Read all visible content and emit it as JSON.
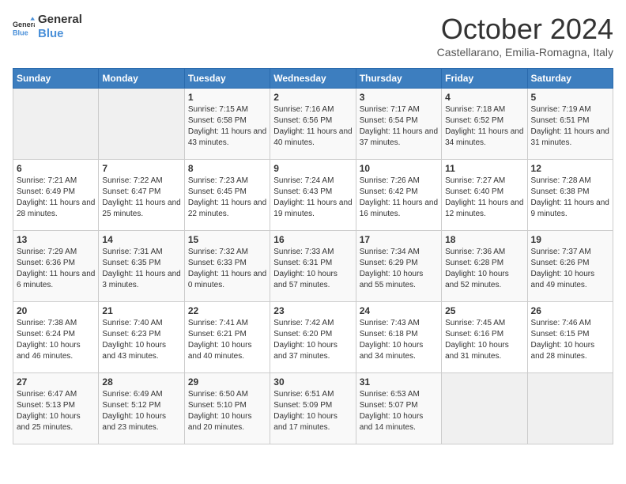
{
  "logo": {
    "line1": "General",
    "line2": "Blue"
  },
  "title": "October 2024",
  "location": "Castellarano, Emilia-Romagna, Italy",
  "headers": [
    "Sunday",
    "Monday",
    "Tuesday",
    "Wednesday",
    "Thursday",
    "Friday",
    "Saturday"
  ],
  "weeks": [
    [
      {
        "day": "",
        "info": ""
      },
      {
        "day": "",
        "info": ""
      },
      {
        "day": "1",
        "info": "Sunrise: 7:15 AM\nSunset: 6:58 PM\nDaylight: 11 hours and 43 minutes."
      },
      {
        "day": "2",
        "info": "Sunrise: 7:16 AM\nSunset: 6:56 PM\nDaylight: 11 hours and 40 minutes."
      },
      {
        "day": "3",
        "info": "Sunrise: 7:17 AM\nSunset: 6:54 PM\nDaylight: 11 hours and 37 minutes."
      },
      {
        "day": "4",
        "info": "Sunrise: 7:18 AM\nSunset: 6:52 PM\nDaylight: 11 hours and 34 minutes."
      },
      {
        "day": "5",
        "info": "Sunrise: 7:19 AM\nSunset: 6:51 PM\nDaylight: 11 hours and 31 minutes."
      }
    ],
    [
      {
        "day": "6",
        "info": "Sunrise: 7:21 AM\nSunset: 6:49 PM\nDaylight: 11 hours and 28 minutes."
      },
      {
        "day": "7",
        "info": "Sunrise: 7:22 AM\nSunset: 6:47 PM\nDaylight: 11 hours and 25 minutes."
      },
      {
        "day": "8",
        "info": "Sunrise: 7:23 AM\nSunset: 6:45 PM\nDaylight: 11 hours and 22 minutes."
      },
      {
        "day": "9",
        "info": "Sunrise: 7:24 AM\nSunset: 6:43 PM\nDaylight: 11 hours and 19 minutes."
      },
      {
        "day": "10",
        "info": "Sunrise: 7:26 AM\nSunset: 6:42 PM\nDaylight: 11 hours and 16 minutes."
      },
      {
        "day": "11",
        "info": "Sunrise: 7:27 AM\nSunset: 6:40 PM\nDaylight: 11 hours and 12 minutes."
      },
      {
        "day": "12",
        "info": "Sunrise: 7:28 AM\nSunset: 6:38 PM\nDaylight: 11 hours and 9 minutes."
      }
    ],
    [
      {
        "day": "13",
        "info": "Sunrise: 7:29 AM\nSunset: 6:36 PM\nDaylight: 11 hours and 6 minutes."
      },
      {
        "day": "14",
        "info": "Sunrise: 7:31 AM\nSunset: 6:35 PM\nDaylight: 11 hours and 3 minutes."
      },
      {
        "day": "15",
        "info": "Sunrise: 7:32 AM\nSunset: 6:33 PM\nDaylight: 11 hours and 0 minutes."
      },
      {
        "day": "16",
        "info": "Sunrise: 7:33 AM\nSunset: 6:31 PM\nDaylight: 10 hours and 57 minutes."
      },
      {
        "day": "17",
        "info": "Sunrise: 7:34 AM\nSunset: 6:29 PM\nDaylight: 10 hours and 55 minutes."
      },
      {
        "day": "18",
        "info": "Sunrise: 7:36 AM\nSunset: 6:28 PM\nDaylight: 10 hours and 52 minutes."
      },
      {
        "day": "19",
        "info": "Sunrise: 7:37 AM\nSunset: 6:26 PM\nDaylight: 10 hours and 49 minutes."
      }
    ],
    [
      {
        "day": "20",
        "info": "Sunrise: 7:38 AM\nSunset: 6:24 PM\nDaylight: 10 hours and 46 minutes."
      },
      {
        "day": "21",
        "info": "Sunrise: 7:40 AM\nSunset: 6:23 PM\nDaylight: 10 hours and 43 minutes."
      },
      {
        "day": "22",
        "info": "Sunrise: 7:41 AM\nSunset: 6:21 PM\nDaylight: 10 hours and 40 minutes."
      },
      {
        "day": "23",
        "info": "Sunrise: 7:42 AM\nSunset: 6:20 PM\nDaylight: 10 hours and 37 minutes."
      },
      {
        "day": "24",
        "info": "Sunrise: 7:43 AM\nSunset: 6:18 PM\nDaylight: 10 hours and 34 minutes."
      },
      {
        "day": "25",
        "info": "Sunrise: 7:45 AM\nSunset: 6:16 PM\nDaylight: 10 hours and 31 minutes."
      },
      {
        "day": "26",
        "info": "Sunrise: 7:46 AM\nSunset: 6:15 PM\nDaylight: 10 hours and 28 minutes."
      }
    ],
    [
      {
        "day": "27",
        "info": "Sunrise: 6:47 AM\nSunset: 5:13 PM\nDaylight: 10 hours and 25 minutes."
      },
      {
        "day": "28",
        "info": "Sunrise: 6:49 AM\nSunset: 5:12 PM\nDaylight: 10 hours and 23 minutes."
      },
      {
        "day": "29",
        "info": "Sunrise: 6:50 AM\nSunset: 5:10 PM\nDaylight: 10 hours and 20 minutes."
      },
      {
        "day": "30",
        "info": "Sunrise: 6:51 AM\nSunset: 5:09 PM\nDaylight: 10 hours and 17 minutes."
      },
      {
        "day": "31",
        "info": "Sunrise: 6:53 AM\nSunset: 5:07 PM\nDaylight: 10 hours and 14 minutes."
      },
      {
        "day": "",
        "info": ""
      },
      {
        "day": "",
        "info": ""
      }
    ]
  ]
}
